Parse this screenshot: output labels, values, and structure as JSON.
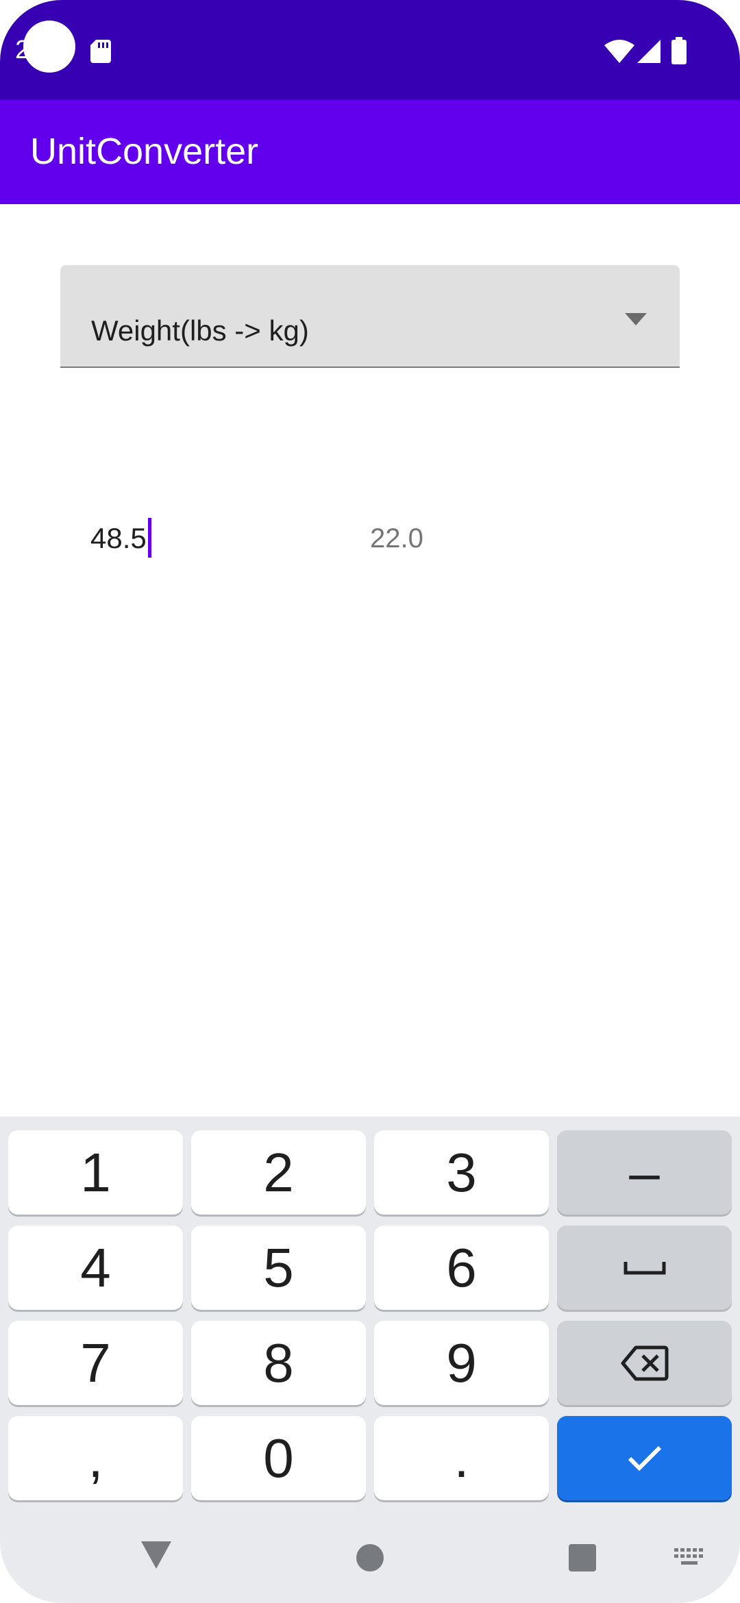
{
  "status_bar": {
    "time": "2",
    "icons": [
      "sd-card-icon",
      "wifi-icon",
      "cell-signal-icon",
      "battery-icon"
    ],
    "background": "#3700b3"
  },
  "app_bar": {
    "title": "UnitConverter",
    "background": "#6200ee"
  },
  "converter": {
    "selected_conversion": "Weight(lbs -> kg)",
    "input_value": "48.5",
    "result_value": "22.0",
    "accent": "#6200ee"
  },
  "keyboard": {
    "keys": {
      "k1": "1",
      "k2": "2",
      "k3": "3",
      "minus": "–",
      "k4": "4",
      "k5": "5",
      "k6": "6",
      "k7": "7",
      "k8": "8",
      "k9": "9",
      "comma": ",",
      "k0": "0",
      "period": "."
    },
    "function_icons": [
      "space-icon",
      "backspace-icon",
      "checkmark-icon"
    ],
    "action_color": "#1a73e8"
  },
  "nav_bar": {
    "icons": [
      "back-icon",
      "home-icon",
      "recents-icon",
      "keyboard-switch-icon"
    ]
  }
}
